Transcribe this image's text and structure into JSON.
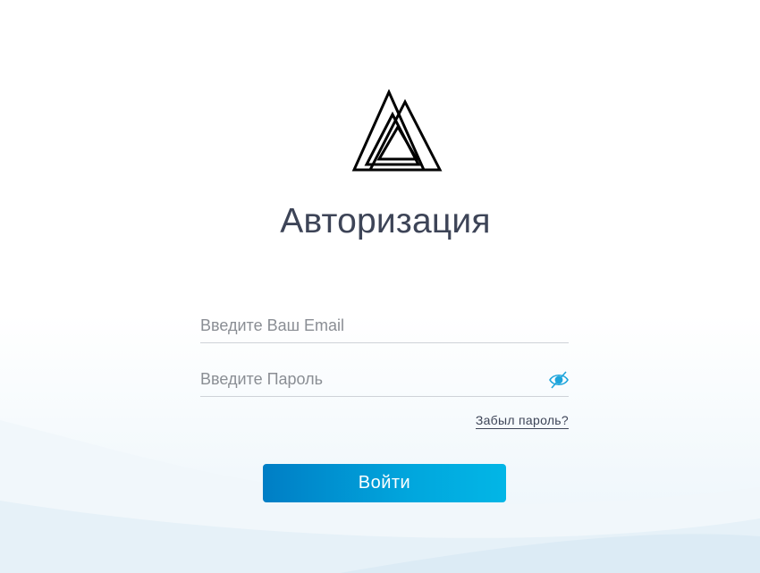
{
  "auth": {
    "title": "Авторизация",
    "email_placeholder": "Введите Ваш Email",
    "email_value": "",
    "password_placeholder": "Введите Пароль",
    "password_value": "",
    "forgot_label": "Забыл пароль?",
    "login_label": "Войти"
  },
  "icons": {
    "logo": "triangles-logo-icon",
    "password_toggle": "eye-slash-icon"
  },
  "colors": {
    "accent_start": "#007ec5",
    "accent_end": "#02b6e6",
    "text_dark": "#3d4457",
    "placeholder": "#8a8e94",
    "eye_icon": "#1ea5dc"
  }
}
